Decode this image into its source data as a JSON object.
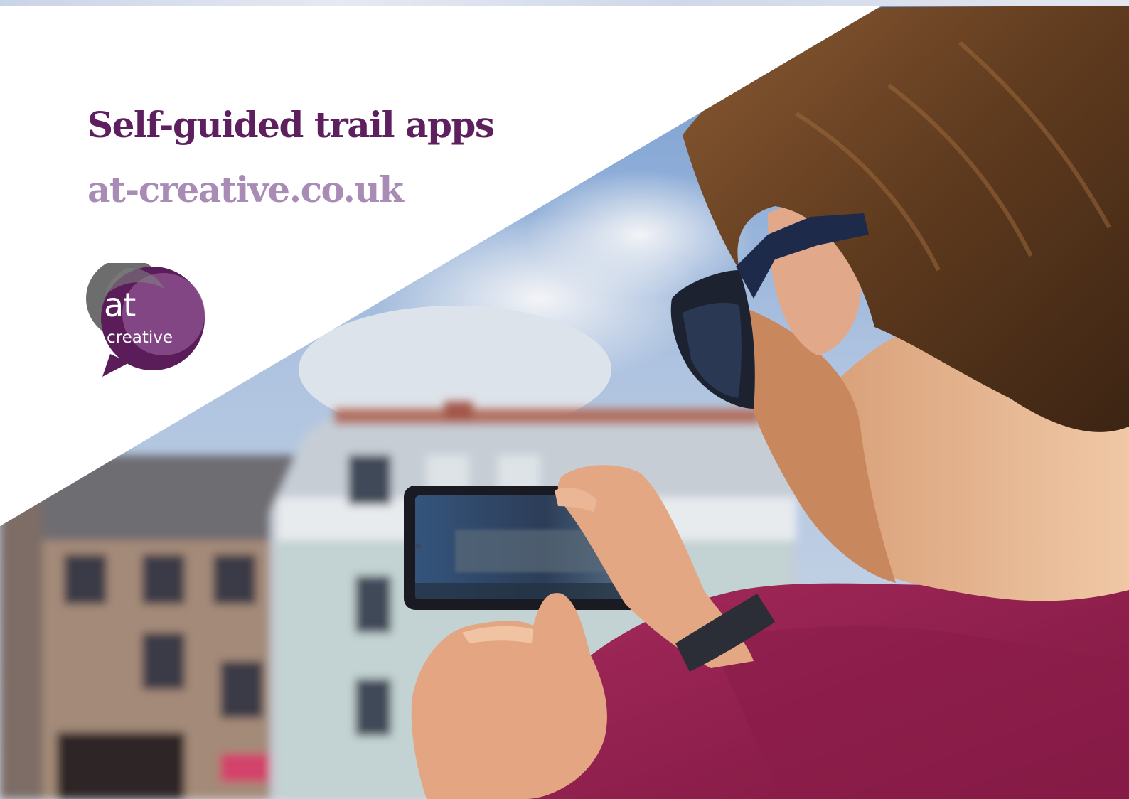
{
  "cover": {
    "title": "Self-guided trail apps",
    "website": "at-creative.co.uk"
  },
  "logo": {
    "line1": "at",
    "line2": "creative",
    "icon": "speech-bubble-logo-icon"
  },
  "colors": {
    "title": "#5e1f5e",
    "website": "#a98cb6",
    "logo_dark": "#5b1d5a",
    "logo_mid": "#8a4d8c",
    "logo_grey": "#6d6d6d",
    "shirt": "#9b1f4f"
  }
}
